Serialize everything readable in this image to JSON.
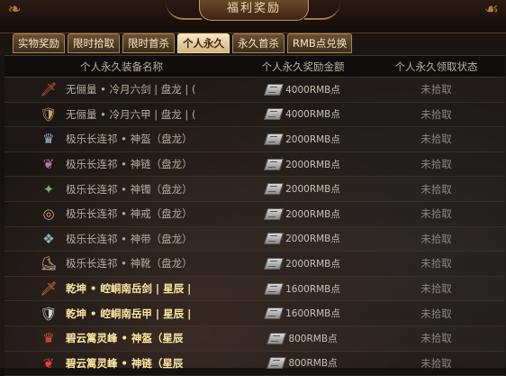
{
  "title": "福利奖励",
  "tabs": [
    {
      "label": "实物奖励",
      "active": false
    },
    {
      "label": "限时拾取",
      "active": false
    },
    {
      "label": "限时首杀",
      "active": false
    },
    {
      "label": "个人永久",
      "active": true
    },
    {
      "label": "永久首杀",
      "active": false
    },
    {
      "label": "RMB点兑换",
      "active": false
    }
  ],
  "table": {
    "headers": [
      "个人永久装备名称",
      "个人永久奖励金额",
      "个人永久领取状态"
    ],
    "rows": [
      {
        "icon": "sword-icon",
        "glyph": "🗡",
        "color": "#e0603a",
        "name": "无俪量 • 冷月六剑 | 盘龙 | (",
        "reward": "4000RMB点",
        "status": "未拾取",
        "highlight": false
      },
      {
        "icon": "armor-icon",
        "glyph": "🛡",
        "color": "#c8a070",
        "name": "无俪量 • 冷月六甲 | 盘龙 | (",
        "reward": "4000RMB点",
        "status": "未拾取",
        "highlight": false
      },
      {
        "icon": "helmet-icon",
        "glyph": "♛",
        "color": "#9ab0c8",
        "name": "极乐长连祁 • 神盔（盘龙）",
        "reward": "2000RMB点",
        "status": "未拾取",
        "highlight": false
      },
      {
        "icon": "necklace-icon",
        "glyph": "❦",
        "color": "#c070b0",
        "name": "极乐长连祁 • 神链（盘龙）",
        "reward": "2000RMB点",
        "status": "未拾取",
        "highlight": false
      },
      {
        "icon": "bracelet-icon",
        "glyph": "✦",
        "color": "#70b060",
        "name": "极乐长连祁 • 神镯（盘龙）",
        "reward": "2000RMB点",
        "status": "未拾取",
        "highlight": false
      },
      {
        "icon": "ring-icon",
        "glyph": "◎",
        "color": "#d0a060",
        "name": "极乐长连祁 • 神戒（盘龙）",
        "reward": "2000RMB点",
        "status": "未拾取",
        "highlight": false
      },
      {
        "icon": "belt-icon",
        "glyph": "❖",
        "color": "#8fb0c0",
        "name": "极乐长连祁 • 神带（盘龙）",
        "reward": "2000RMB点",
        "status": "未拾取",
        "highlight": false
      },
      {
        "icon": "boots-icon",
        "glyph": "⛸",
        "color": "#d0b090",
        "name": "极乐长连祁 • 神靴（盘龙）",
        "reward": "2000RMB点",
        "status": "未拾取",
        "highlight": false
      },
      {
        "icon": "sword-icon",
        "glyph": "🗡",
        "color": "#f07030",
        "name": "乾坤 • 崆峒南岳剑 | 星辰 |",
        "reward": "1600RMB点",
        "status": "未拾取",
        "highlight": true
      },
      {
        "icon": "armor-icon",
        "glyph": "🛡",
        "color": "#d0d0d0",
        "name": "乾坤 • 崆峒南岳甲 | 星辰 |",
        "reward": "1600RMB点",
        "status": "未拾取",
        "highlight": true
      },
      {
        "icon": "helmet-icon",
        "glyph": "♛",
        "color": "#e05030",
        "name": "碧云篱灵峰 • 神盔（星辰",
        "reward": "800RMB点",
        "status": "未拾取",
        "highlight": true
      },
      {
        "icon": "necklace-icon",
        "glyph": "❦",
        "color": "#f04030",
        "name": "碧云篱灵峰 • 神链（星辰",
        "reward": "800RMB点",
        "status": "未拾取",
        "highlight": true
      }
    ]
  }
}
